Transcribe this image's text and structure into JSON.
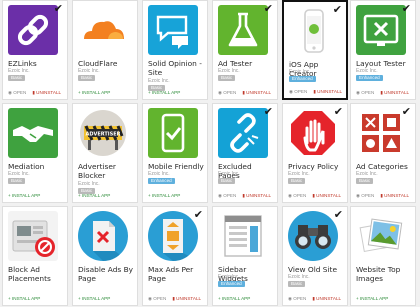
{
  "colors": {
    "card_bg": "#ffffff",
    "card_border": "#dedede",
    "selected_border": "#111111",
    "tag_basic": "#b9b9b9",
    "tag_enhanced": "#5fb0dd",
    "action_green": "#2a8a36",
    "action_red": "#c0392b"
  },
  "apps": [
    {
      "title": "EZLinks",
      "publisher": "Ezoic Inc.",
      "tag": "Basic",
      "installed": true,
      "selected": false,
      "icon": "link-icon"
    },
    {
      "title": "CloudFlare",
      "publisher": "Ezoic Inc.",
      "tag": "Basic",
      "installed": false,
      "selected": false,
      "icon": "cloud-icon"
    },
    {
      "title": "Solid Opinion - Site Comments",
      "publisher": "Ezoic Inc.",
      "tag": "Basic",
      "installed": false,
      "selected": false,
      "icon": "comment-bubbles-icon"
    },
    {
      "title": "Ad Tester",
      "publisher": "Ezoic Inc.",
      "tag": "Basic",
      "installed": true,
      "selected": false,
      "icon": "flask-icon"
    },
    {
      "title": "iOS App Creator",
      "publisher": "Ezoic Inc.",
      "tag": "Enhanced",
      "installed": true,
      "selected": true,
      "icon": "phone-icon"
    },
    {
      "title": "Layout Tester",
      "publisher": "Ezoic Inc.",
      "tag": "Enhanced",
      "installed": true,
      "selected": false,
      "icon": "layout-x-icon"
    },
    {
      "title": "Mediation",
      "publisher": "Ezoic Inc.",
      "tag": "Basic",
      "installed": false,
      "selected": false,
      "icon": "handshake-icon"
    },
    {
      "title": "Advertiser Blocker",
      "publisher": "Ezoic Inc.",
      "tag": "Basic",
      "installed": false,
      "selected": false,
      "icon": "advertiser-block-icon"
    },
    {
      "title": "Mobile Friendly",
      "publisher": "Ezoic Inc.",
      "tag": "Enhanced",
      "installed": false,
      "selected": false,
      "icon": "mobile-friendly-icon"
    },
    {
      "title": "Excluded Pages",
      "publisher": "Ezoic Inc.",
      "tag": "Basic",
      "installed": true,
      "selected": false,
      "icon": "broken-link-icon"
    },
    {
      "title": "Privacy Policy",
      "publisher": "Ezoic Inc.",
      "tag": "Basic",
      "installed": true,
      "selected": false,
      "icon": "stop-hand-icon"
    },
    {
      "title": "Ad Categories",
      "publisher": "Ezoic Inc.",
      "tag": "Basic",
      "installed": true,
      "selected": false,
      "icon": "categories-icon"
    },
    {
      "title": "Block Ad Placements",
      "publisher": "",
      "tag": "",
      "installed": false,
      "selected": false,
      "icon": "block-placement-icon"
    },
    {
      "title": "Disable Ads By Page",
      "publisher": "",
      "tag": "",
      "installed": false,
      "selected": false,
      "icon": "disable-ads-icon"
    },
    {
      "title": "Max Ads Per Page",
      "publisher": "",
      "tag": "",
      "installed": true,
      "selected": false,
      "icon": "max-ads-icon"
    },
    {
      "title": "Sidebar Widgets",
      "publisher": "Ezoic Inc.",
      "tag": "Enhanced",
      "installed": false,
      "selected": false,
      "icon": "sidebar-widget-icon"
    },
    {
      "title": "View Old Site",
      "publisher": "Ezoic Inc.",
      "tag": "Basic",
      "installed": true,
      "selected": false,
      "icon": "binoculars-icon"
    },
    {
      "title": "Website Top Images",
      "publisher": "",
      "tag": "",
      "installed": false,
      "selected": false,
      "icon": "photos-icon"
    }
  ],
  "labels": {
    "open": "OPEN",
    "uninstall": "UNINSTALL",
    "install": "INSTALL APP",
    "check": "✔"
  }
}
